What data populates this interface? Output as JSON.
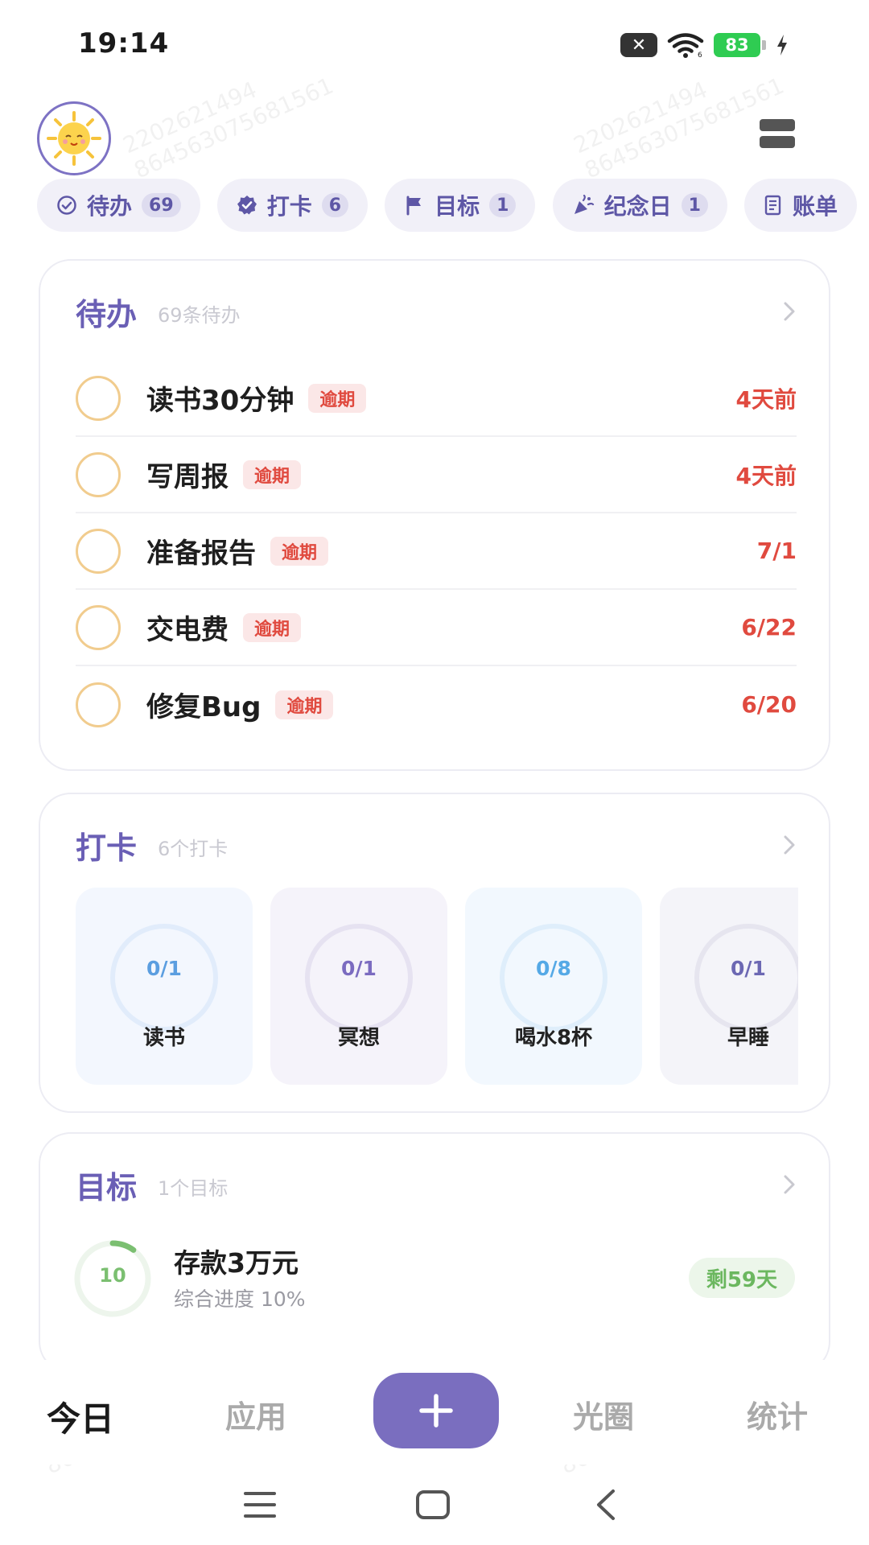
{
  "status_bar": {
    "time": "19:14",
    "notification_badge": "✕",
    "battery_level": "83",
    "icons": [
      "close-notification-icon",
      "wifi-icon",
      "battery-icon",
      "charging-icon"
    ]
  },
  "header": {
    "avatar_icon": "sun-avatar-icon",
    "menu_icon": "menu-icon"
  },
  "chips": [
    {
      "label": "待办",
      "count": "69",
      "icon": "check-circle-icon"
    },
    {
      "label": "打卡",
      "count": "6",
      "icon": "verified-badge-icon"
    },
    {
      "label": "目标",
      "count": "1",
      "icon": "flag-icon"
    },
    {
      "label": "纪念日",
      "count": "1",
      "icon": "celebration-icon"
    },
    {
      "label": "账单",
      "icon": "receipt-icon"
    }
  ],
  "todo_card": {
    "title": "待办",
    "subtitle": "69条待办",
    "items": [
      {
        "name": "读书30分钟",
        "tag": "逾期",
        "due": "4天前"
      },
      {
        "name": "写周报",
        "tag": "逾期",
        "due": "4天前"
      },
      {
        "name": "准备报告",
        "tag": "逾期",
        "due": "7/1"
      },
      {
        "name": "交电费",
        "tag": "逾期",
        "due": "6/22"
      },
      {
        "name": "修复Bug",
        "tag": "逾期",
        "due": "6/20"
      }
    ]
  },
  "checkin_card": {
    "title": "打卡",
    "subtitle": "6个打卡",
    "items": [
      {
        "value": "0/1",
        "name": "读书",
        "progress": 0,
        "bg": "#f3f7fe",
        "ring": "#e1ecfb",
        "text": "#5b9ee0"
      },
      {
        "value": "0/1",
        "name": "冥想",
        "progress": 0,
        "bg": "#f5f3fa",
        "ring": "#e6e2f1",
        "text": "#7b6bc0"
      },
      {
        "value": "0/8",
        "name": "喝水8杯",
        "progress": 0,
        "bg": "#f2f8fe",
        "ring": "#dfeefb",
        "text": "#55a9e6"
      },
      {
        "value": "0/1",
        "name": "早睡",
        "progress": 0,
        "bg": "#f4f4f9",
        "ring": "#e6e5ef",
        "text": "#6c68b3"
      }
    ]
  },
  "goal_card": {
    "title": "目标",
    "subtitle": "1个目标",
    "goal": {
      "value": "10",
      "name": "存款3万元",
      "progress_text": "综合进度 10%",
      "progress": 0.1,
      "remaining": "剩59天"
    }
  },
  "tab_bar": {
    "tabs": [
      {
        "label": "今日",
        "active": true
      },
      {
        "label": "应用",
        "active": false
      },
      {
        "label": "光圈",
        "active": false
      },
      {
        "label": "统计",
        "active": false
      }
    ],
    "add_icon": "plus-icon",
    "accent": "#7a6ebf"
  },
  "watermark": {
    "line1": "2202621494",
    "line2": "864563075681561"
  },
  "colors": {
    "accent": "#6a5fb5",
    "overdue": "#e04a3f",
    "goal": "#7bbf71"
  }
}
